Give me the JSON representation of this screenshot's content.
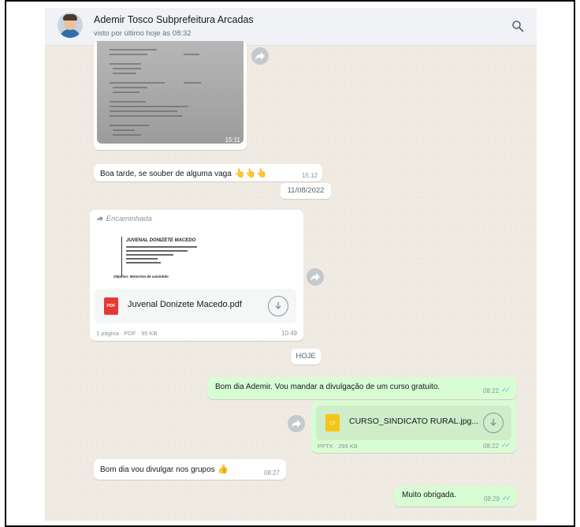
{
  "header": {
    "contact_name": "Ademir Tosco Subprefeitura Arcadas",
    "last_seen": "visto por último hoje às 08:32"
  },
  "messages": {
    "image_doc": {
      "time": "15:11"
    },
    "vaga": {
      "text": "Boa tarde, se souber de alguma vaga",
      "emoji": "👆👆👆",
      "time": "15:12"
    },
    "date_divider": "11/08/2022",
    "forwarded_doc": {
      "forwarded_label": "Encaminhada",
      "preview_name": "JUVENAL DONIZETE MACEDO",
      "preview_objective": "Objetivo: Motorista de caminhão",
      "file_type": "PDF",
      "file_name": "Juvenal Donizete Macedo.pdf",
      "meta": "1 página · PDF · 95 KB",
      "time": "10:49"
    },
    "today_divider": "HOJE",
    "bom_dia_ademir": {
      "text": "Bom dia Ademir. Vou mandar a divulgação de um curso gratuito.",
      "time": "08:22"
    },
    "curso_file": {
      "file_type": "PPTX",
      "file_name": "CURSO_SINDICATO RURAL.jpg...",
      "meta": "PPTX · 299 KB",
      "time": "08:22"
    },
    "grupos": {
      "text": "Bom dia vou divulgar nos grupos",
      "emoji": "👍",
      "time": "08:27"
    },
    "obrigada": {
      "text": "Muito obrigada.",
      "time": "08:29"
    }
  },
  "colors": {
    "outgoing": "#d9fdd3",
    "incoming": "#ffffff",
    "pdf_red": "#e53935",
    "pptx_yellow": "#f5c518",
    "read_ticks": "#53bdeb"
  }
}
